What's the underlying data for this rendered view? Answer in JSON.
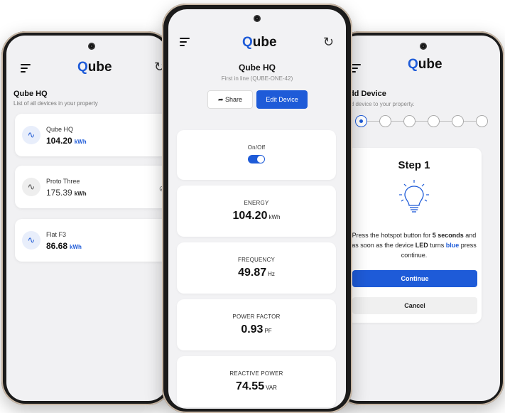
{
  "left": {
    "logo": "Qube",
    "title": "Qube HQ",
    "subtitle": "List of all devices in your property",
    "devices": [
      {
        "name": "Qube HQ",
        "value": "104.20",
        "unit": "kWh"
      },
      {
        "name": "Proto Three",
        "value": "175.39",
        "unit": "kWh"
      },
      {
        "name": "Flat F3",
        "value": "86.68",
        "unit": "kWh"
      }
    ]
  },
  "center": {
    "logo": "Qube",
    "title": "Qube HQ",
    "subtitle": "First in line (QUBE-ONE-42)",
    "share_label": "Share",
    "edit_label": "Edit Device",
    "onoff_label": "On/Off",
    "onoff_state": true,
    "metrics": [
      {
        "label": "ENERGY",
        "value": "104.20",
        "unit": "kWh"
      },
      {
        "label": "FREQUENCY",
        "value": "49.87",
        "unit": "Hz"
      },
      {
        "label": "POWER FACTOR",
        "value": "0.93",
        "unit": "PF"
      },
      {
        "label": "REACTIVE POWER",
        "value": "74.55",
        "unit": "VAR"
      }
    ]
  },
  "right": {
    "logo": "Qube",
    "title": "Add Device",
    "subtitle": "Add device to your property.",
    "step_title": "Step 1",
    "instruction": {
      "p1": "Press the hotspot button for ",
      "b1": "5 seconds",
      "p2": " and as soon as the device ",
      "b2": "LED",
      "p3": " turns ",
      "b3": "blue",
      "p4": " press continue."
    },
    "continue_label": "Continue",
    "cancel_label": "Cancel"
  },
  "colors": {
    "accent": "#1e5bd8",
    "background": "#f1f1f3",
    "frame": "#1b1b1b"
  }
}
